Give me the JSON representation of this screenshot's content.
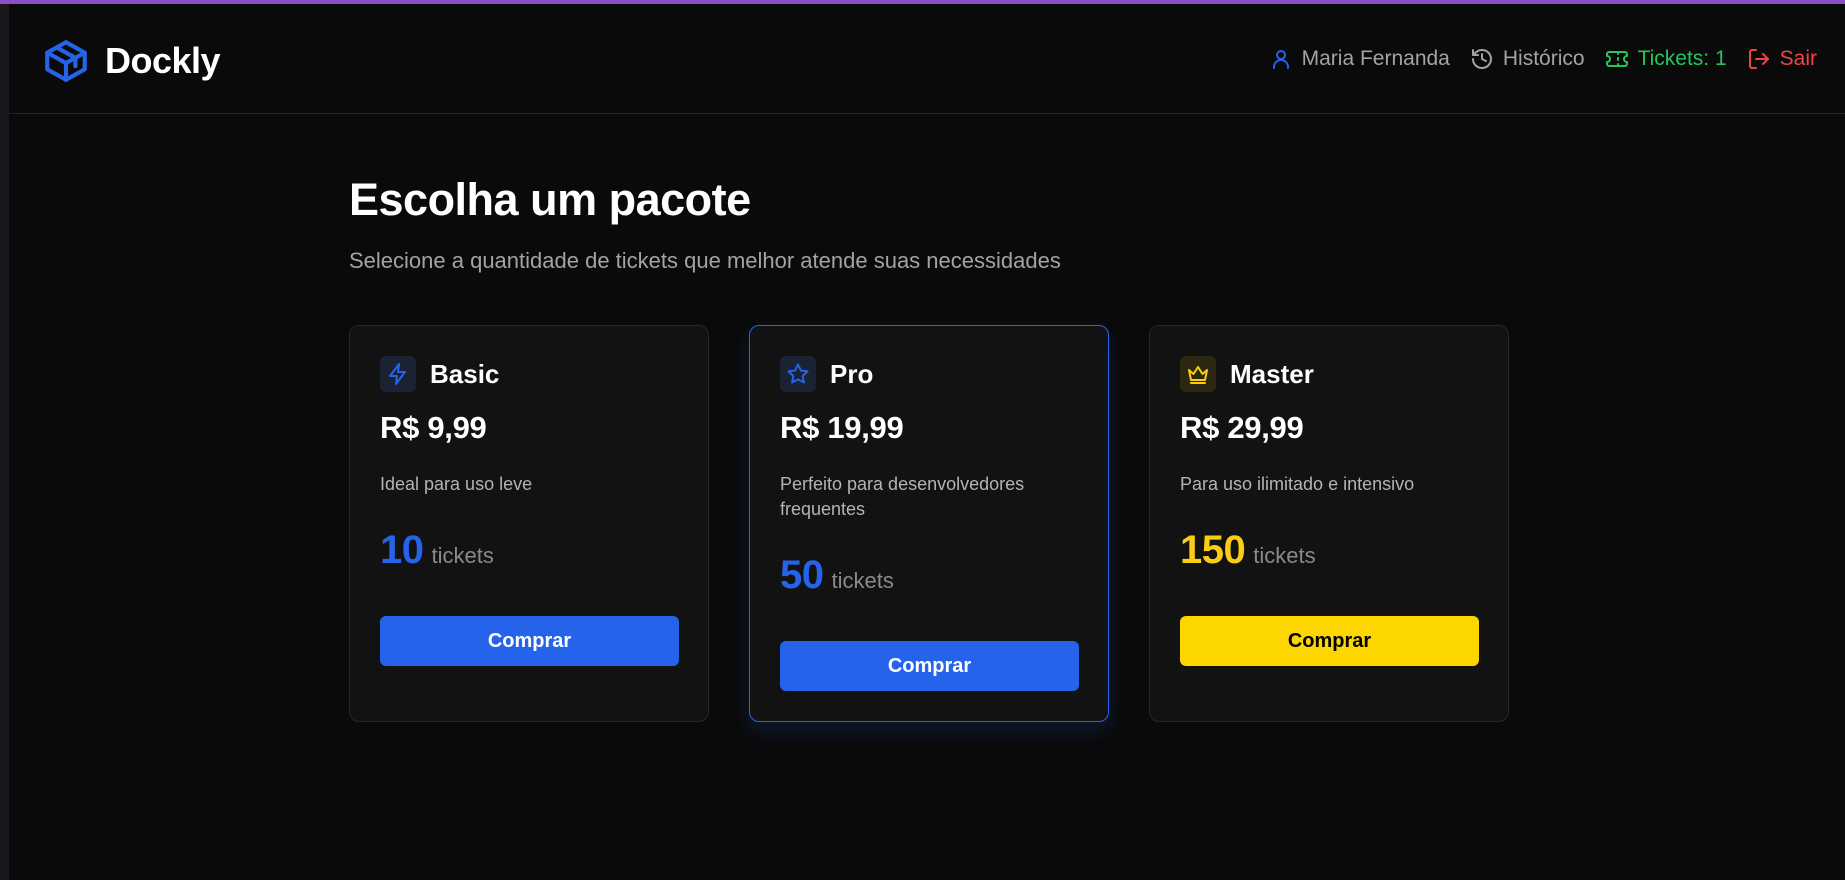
{
  "brand": {
    "name": "Dockly",
    "icon": "box-icon"
  },
  "nav": {
    "user": {
      "label": "Maria Fernanda",
      "icon": "user-icon"
    },
    "history": {
      "label": "Histórico",
      "icon": "history-icon"
    },
    "tickets": {
      "label": "Tickets: 1",
      "icon": "ticket-icon"
    },
    "logout": {
      "label": "Sair",
      "icon": "logout-icon"
    }
  },
  "page": {
    "title": "Escolha um pacote",
    "subtitle": "Selecione a quantidade de tickets que melhor atende suas necessidades"
  },
  "packages": [
    {
      "name": "Basic",
      "icon": "lightning-icon",
      "price": "R$ 9,99",
      "description": "Ideal para uso leve",
      "quantity": "10",
      "unit": "tickets",
      "button": "Comprar"
    },
    {
      "name": "Pro",
      "icon": "star-icon",
      "price": "R$ 19,99",
      "description": "Perfeito para desenvolvedores frequentes",
      "quantity": "50",
      "unit": "tickets",
      "button": "Comprar"
    },
    {
      "name": "Master",
      "icon": "crown-icon",
      "price": "R$ 29,99",
      "description": "Para uso ilimitado e intensivo",
      "quantity": "150",
      "unit": "tickets",
      "button": "Comprar"
    }
  ],
  "colors": {
    "accent_blue": "#2563eb",
    "accent_yellow": "#fdd600",
    "tickets_green": "#22c55e",
    "logout_red": "#ef4444",
    "top_bar_purple": "#8a4fc7",
    "background": "#0a0a0a",
    "card_background": "#121212"
  }
}
